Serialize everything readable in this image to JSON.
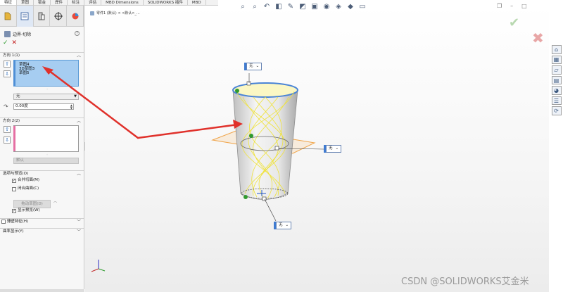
{
  "top_tabs": [
    "特征",
    "草图",
    "钣金",
    "焊件",
    "标注",
    "评估",
    "MBD Dimensions",
    "SOLIDWORKS 插件",
    "MBD"
  ],
  "panel": {
    "feature_title": "边界-切除",
    "help": "?",
    "ok": "✓",
    "cancel": "✕",
    "direction1": {
      "label": "方向 1(1)",
      "items": [
        "草图4",
        "3D草图3",
        "草图5"
      ],
      "tangent_option": "无",
      "angle_value": "0.00度"
    },
    "direction2": {
      "label": "方向 2(2)",
      "disabled_button": "默认"
    },
    "options": {
      "label": "选项与预览(O)",
      "merge_tangent": "合并切面(M)",
      "closed_surface": "闭合曲面(C)",
      "rebuild_button": "拖动草图(D)",
      "rebuild_suffix": "⌒",
      "show_preview": "显示预览(W)"
    },
    "thin_feature": "薄壁特征(H)",
    "curvature_display": "曲率显示(Y)"
  },
  "viewport": {
    "tree_path": "零件1 (默认) < <默认>_..."
  },
  "callouts": {
    "top": "无",
    "right": "无",
    "bottom": "无"
  },
  "watermark": "CSDN @SOLIDWORKS艾金米",
  "colors": {
    "selection_blue": "#a6cdf1",
    "red_arrow": "#e0312b",
    "yellow_guides": "#efe23a",
    "plane_orange": "#f0a448",
    "ok_green": "#2f9a2f"
  }
}
